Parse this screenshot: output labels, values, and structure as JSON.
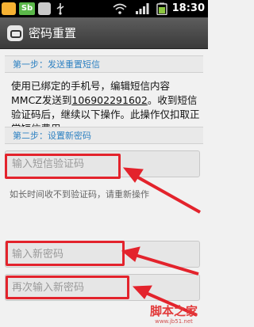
{
  "status_bar": {
    "app_badge": "Sb",
    "time": "18:30",
    "icons": [
      "app-icon",
      "app-icon",
      "app-icon",
      "usb-icon",
      "wifi-icon",
      "signal-icon",
      "battery-icon"
    ]
  },
  "app_bar": {
    "title": "密码重置",
    "icon": "chat-bubble-icon"
  },
  "step1": {
    "title": "第一步：发送重置短信",
    "description_before": "使用已绑定的手机号，编辑短信内容MMCZ发送到",
    "phone_number": "106902291602",
    "description_after": "。收到短信验证码后，继续以下操作。此操作仅扣取正常短信费用。"
  },
  "step2": {
    "title": "第二步：设置新密码",
    "verification_code": {
      "placeholder": "输入短信验证码",
      "value": ""
    },
    "hint": "如长时间收不到验证码，请重新操作",
    "new_password": {
      "placeholder": "输入新密码",
      "value": ""
    },
    "confirm_password": {
      "placeholder": "再次输入新密码",
      "value": ""
    }
  },
  "annotations": {
    "highlight_color": "#e3232c"
  },
  "watermark": {
    "main": "脚本之家",
    "sub": "www.jb51.net"
  }
}
